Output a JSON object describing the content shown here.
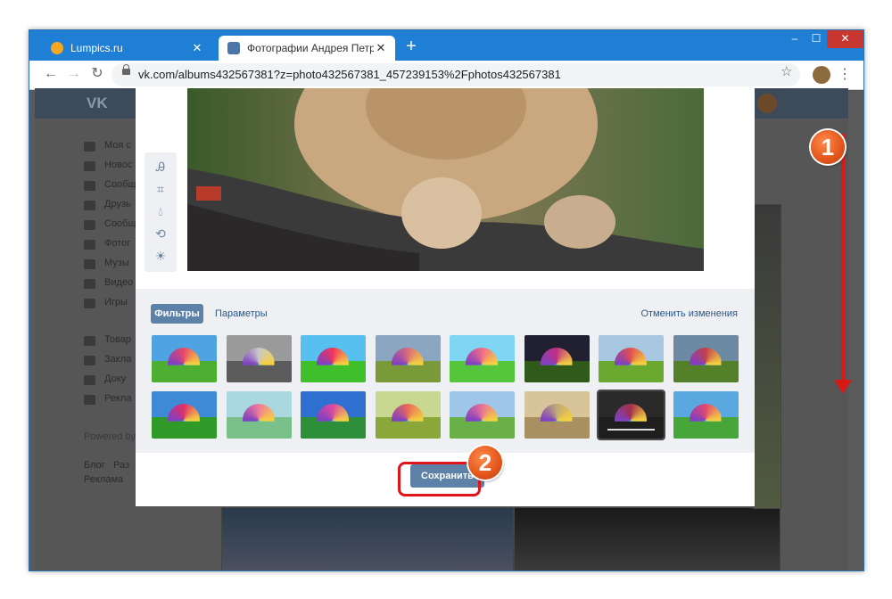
{
  "browser": {
    "tabs": [
      {
        "title": "Lumpics.ru",
        "favicon_color": "#f5a623"
      },
      {
        "title": "Фотографии Андрея Петрова –",
        "favicon_color": "#4a76a8"
      }
    ],
    "new_tab": "+",
    "window_controls": {
      "minimize": "–",
      "maximize": "☐",
      "close": "✕"
    },
    "url": "vk.com/albums432567381?z=photo432567381_457239153%2Fphotos432567381"
  },
  "vk": {
    "logo": "VK",
    "sidebar": [
      {
        "label": "Моя с",
        "icon": "home-icon"
      },
      {
        "label": "Новос",
        "icon": "news-icon"
      },
      {
        "label": "Сообщ",
        "icon": "messages-icon"
      },
      {
        "label": "Друзь",
        "icon": "friends-icon"
      },
      {
        "label": "Сообщ",
        "icon": "communities-icon"
      },
      {
        "label": "Фотог",
        "icon": "photos-icon"
      },
      {
        "label": "Музы",
        "icon": "music-icon"
      },
      {
        "label": "Видео",
        "icon": "video-icon"
      },
      {
        "label": "Игры",
        "icon": "games-icon"
      },
      {
        "label": "Товар",
        "icon": "goods-icon"
      },
      {
        "label": "Закла",
        "icon": "bookmarks-icon"
      },
      {
        "label": "Доку",
        "icon": "documents-icon"
      },
      {
        "label": "Рекла",
        "icon": "ads-icon"
      }
    ],
    "powered_by": "Powered by",
    "footer_links": [
      "Блог",
      "Раз",
      "Реклама"
    ]
  },
  "editor": {
    "tabs": {
      "filters": "Фильтры",
      "params": "Параметры"
    },
    "undo": "Отменить изменения",
    "save": "Сохранить",
    "tools": [
      "text-tool-icon",
      "crop-tool-icon",
      "blur-tool-icon",
      "rotate-tool-icon",
      "auto-correct-icon"
    ],
    "filters": [
      {
        "sky": "#4fa3e0",
        "grass": "#4caf32",
        "umb": "#e8486a"
      },
      {
        "sky": "#9a9a9a",
        "grass": "#5c5c5c",
        "umb": "#c8c8c8"
      },
      {
        "sky": "#58c0f0",
        "grass": "#3fbf2a",
        "umb": "#f0345c"
      },
      {
        "sky": "#8aa6c0",
        "grass": "#7a9a3a",
        "umb": "#d86a7a"
      },
      {
        "sky": "#7fd6f2",
        "grass": "#55c53c",
        "umb": "#f06a8a"
      },
      {
        "sky": "#202030",
        "grass": "#2f5a1a",
        "umb": "#c03080"
      },
      {
        "sky": "#a7c8e0",
        "grass": "#6aa830",
        "umb": "#e05050"
      },
      {
        "sky": "#6d8aa5",
        "grass": "#55802a",
        "umb": "#c04050"
      },
      {
        "sky": "#3f8ad6",
        "grass": "#2f9a28",
        "umb": "#e0306a"
      },
      {
        "sky": "#a9d8e0",
        "grass": "#7ac08a",
        "umb": "#f07a9a"
      },
      {
        "sky": "#2f6fd0",
        "grass": "#2e8f3a",
        "umb": "#d84aa0"
      },
      {
        "sky": "#c9d890",
        "grass": "#8aa83a",
        "umb": "#e86a5a"
      },
      {
        "sky": "#9fc6e8",
        "grass": "#6ab048",
        "umb": "#e87098"
      },
      {
        "sky": "#d8c49a",
        "grass": "#a89060",
        "umb": "#c0a878"
      },
      {
        "sky": "#2a2a2a",
        "grass": "#1e1e1e",
        "umb": "#a0304a"
      },
      {
        "sky": "#5aa8e0",
        "grass": "#46a63a",
        "umb": "#e24870"
      }
    ],
    "selected_filter": 14
  },
  "annotations": {
    "step1": "1",
    "step2": "2",
    "color": "#e0141b"
  }
}
